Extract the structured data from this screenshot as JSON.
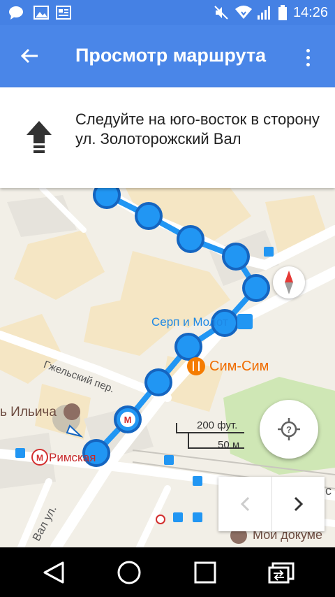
{
  "status_bar": {
    "time": "14:26",
    "left_icons": [
      "chat-icon",
      "image-icon",
      "news-icon"
    ],
    "right_icons": [
      "mute-icon",
      "wifi-icon",
      "signal-icon",
      "battery-icon"
    ]
  },
  "app_bar": {
    "title": "Просмотр маршрута",
    "background": "#4a86e8"
  },
  "instruction": {
    "text": "Следуйте на юго-восток в сторону ул. Золоторожский Вал",
    "icon": "straight-arrow-icon"
  },
  "map": {
    "labels": {
      "serp_i_molot": "Серп и Молот",
      "sim_sim": "Сим-Сим",
      "gzhelsky": "Гжельский пер.",
      "ilyicha": "ь Ильича",
      "rimskaya": "Римская",
      "val_ul": "Вал ул.",
      "moi_docs": "Мои докуме",
      "scale_ft": "200 фут.",
      "scale_m": "50 м",
      "edge_letter": "с"
    },
    "route_color": "#2196f3",
    "route_dot_border": "#1565c0"
  },
  "controls": {
    "compass": "compass-icon",
    "my_location": "my-location-icon",
    "prev_step": "chevron-left-icon",
    "next_step": "chevron-right-icon"
  },
  "nav_bar": {
    "buttons": [
      "back-triangle-icon",
      "home-circle-icon",
      "recents-square-icon",
      "switch-screen-icon"
    ]
  }
}
